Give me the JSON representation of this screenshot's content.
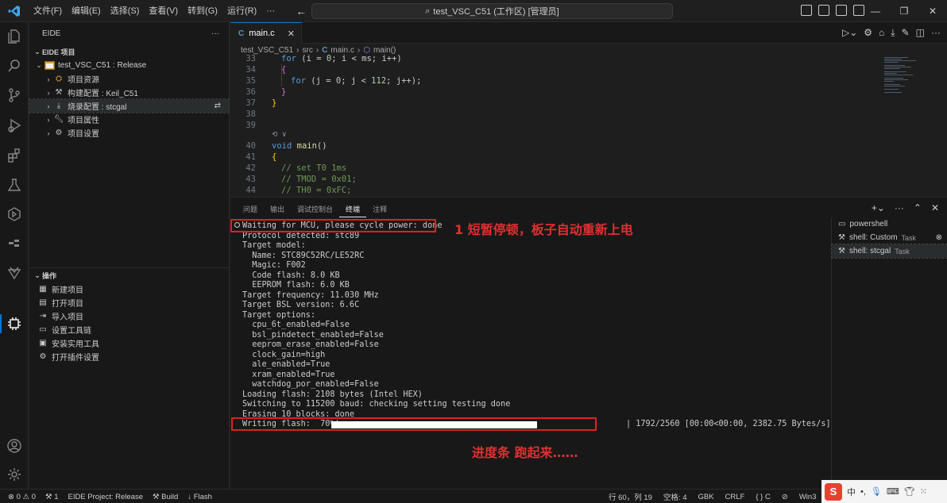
{
  "titlebar": {
    "menus": [
      "文件(F)",
      "编辑(E)",
      "选择(S)",
      "查看(V)",
      "转到(G)",
      "运行(R)",
      "···"
    ],
    "command_center": "test_VSC_C51 (工作区) [管理员]"
  },
  "sidebar": {
    "title": "EIDE",
    "more": "···",
    "section_project": "EIDE 项目",
    "project_name": "test_VSC_C51 : Release",
    "items": [
      "项目资源",
      "构建配置 : Keil_C51",
      "烧录配置 : stcgal",
      "项目属性",
      "项目设置"
    ],
    "section_ops": "操作",
    "ops": [
      "新建项目",
      "打开项目",
      "导入项目",
      "设置工具链",
      "安装实用工具",
      "打开插件设置"
    ]
  },
  "editor": {
    "tab_label": "main.c",
    "tab_icon": "C",
    "breadcrumb": [
      "test_VSC_C51",
      "src",
      "main.c",
      "main()"
    ],
    "lines": [
      {
        "n": "33",
        "html": "<span class='kw'>for</span> (i = <span class='num'>0</span>; i &lt; ms; i++)",
        "indent": 2
      },
      {
        "n": "34",
        "html": "<span class='br1'>{</span>",
        "indent": 2
      },
      {
        "n": "35",
        "html": "<span class='kw'>for</span> (j = <span class='num'>0</span>; j &lt; <span class='num'>112</span>; j++);",
        "indent": 4
      },
      {
        "n": "36",
        "html": "<span class='br1'>}</span>",
        "indent": 2
      },
      {
        "n": "37",
        "html": "<span class='br0'>}</span>",
        "indent": 0
      },
      {
        "n": "38",
        "html": "",
        "indent": 0
      },
      {
        "n": "39",
        "html": "",
        "indent": 0
      },
      {
        "n": "40",
        "html": "<span class='kw'>void</span> <span class='fn'>main</span>()",
        "indent": 0
      },
      {
        "n": "41",
        "html": "<span class='br0'>{</span>",
        "indent": 0
      },
      {
        "n": "42",
        "html": "<span class='cm'>// set T0 1ms</span>",
        "indent": 2
      },
      {
        "n": "43",
        "html": "<span class='cm'>// TMOD = 0x01;</span>",
        "indent": 2
      },
      {
        "n": "44",
        "html": "<span class='cm'>// TH0 = 0xFC;</span>",
        "indent": 2
      }
    ],
    "codelens": "⟲ ∨"
  },
  "panel": {
    "tabs": [
      "问题",
      "输出",
      "调试控制台",
      "终端",
      "注释"
    ],
    "active_tab": "终端",
    "terminal_lines": [
      "Waiting for MCU, please cycle power: done",
      "Protocol detected: stc89",
      "Target model:",
      "  Name: STC89C52RC/LE52RC",
      "  Magic: F002",
      "  Code flash: 8.0 KB",
      "  EEPROM flash: 6.0 KB",
      "Target frequency: 11.030 MHz",
      "Target BSL version: 6.6C",
      "Target options:",
      "  cpu_6t_enabled=False",
      "  bsl_pindetect_enabled=False",
      "  eeprom_erase_enabled=False",
      "  clock_gain=high",
      "  ale_enabled=True",
      "  xram_enabled=True",
      "  watchdog_por_enabled=False",
      "Loading flash: 2108 bytes (Intel HEX)",
      "Switching to 115200 baud: checking setting testing done",
      "Erasing 10 blocks: done"
    ],
    "writing_label": "Writing flash:  70%|",
    "progress_fraction": 0.7,
    "progress_stats": "| 1792/2560 [00:00<00:00, 2382.75 Bytes/s]",
    "annotation_1": "1  短暂停顿，板子自动重新上电",
    "annotation_2": "进度条 跑起来……",
    "terminals": [
      {
        "name": "powershell",
        "task": ""
      },
      {
        "name": "shell: Custom",
        "task": "Task"
      },
      {
        "name": "shell: stcgal",
        "task": "Task"
      }
    ]
  },
  "statusbar": {
    "errors": "0",
    "warnings": "0",
    "ports": "1",
    "project": "EIDE Project: Release",
    "build": "Build",
    "flash": "Flash",
    "position": "行 60，列 19",
    "spaces": "空格: 4",
    "encoding": "GBK",
    "eol": "CRLF",
    "language": "{ } C",
    "platform": "Win3"
  },
  "tray": {
    "logo": "S",
    "ime": "中"
  },
  "colors": {
    "accent": "#0078d4",
    "annotation": "#e02020",
    "editor_bg": "#1e1e1e"
  }
}
